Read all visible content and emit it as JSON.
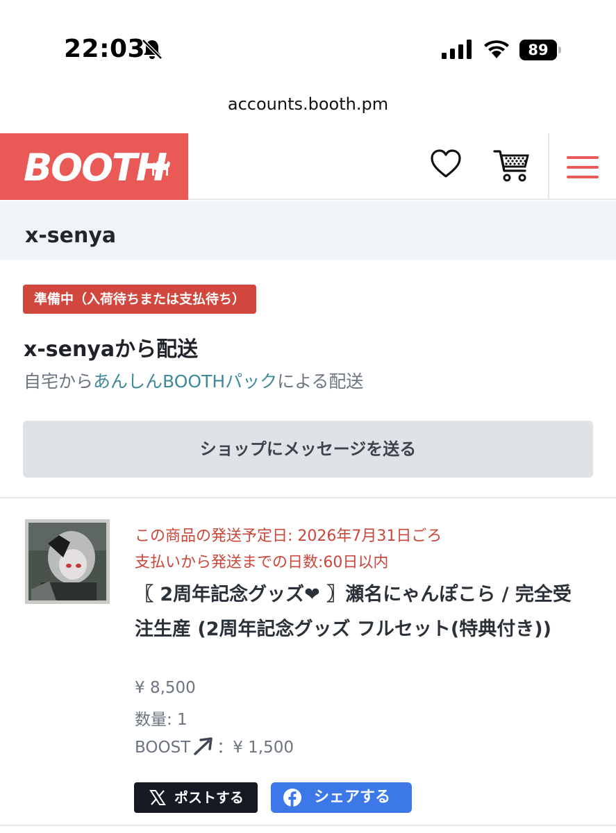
{
  "status_bar": {
    "time": "22:03",
    "battery": "89",
    "icons": [
      "bell-slash-icon",
      "cellular-signal-icon",
      "wifi-icon",
      "battery-icon"
    ]
  },
  "browser": {
    "url": "accounts.booth.pm"
  },
  "header": {
    "logo": "BOOTH",
    "brand_color": "#e95a56",
    "icons": [
      "heart-icon",
      "cart-icon",
      "hamburger-menu-icon"
    ]
  },
  "shop": {
    "name": "x-senya"
  },
  "order": {
    "status_badge": "準備中（入荷待ちまたは支払待ち）",
    "status_color": "#d1473d",
    "ship_title": "x-senyaから配送",
    "ship_sub_prefix": "自宅から",
    "ship_sub_link": "あんしんBOOTHパック",
    "ship_sub_suffix": "による配送",
    "message_button": "ショップにメッセージを送る"
  },
  "product": {
    "ship_date": "この商品の発送予定日: 2026年7月31日ごろ",
    "ship_days": "支払いから発送までの日数:60日以内",
    "title": "〖 2周年記念グッズ❤ 〗瀬名にゃんぽこら / 完全受注生産 (2周年記念グッズ フルセット(特典付き))",
    "price": "¥ 8,500",
    "quantity": "数量: 1",
    "boost_label": "BOOST",
    "boost_value": "：¥ 1,500"
  },
  "share": {
    "x_label": "ポストする",
    "fb_label": "シェアする"
  }
}
